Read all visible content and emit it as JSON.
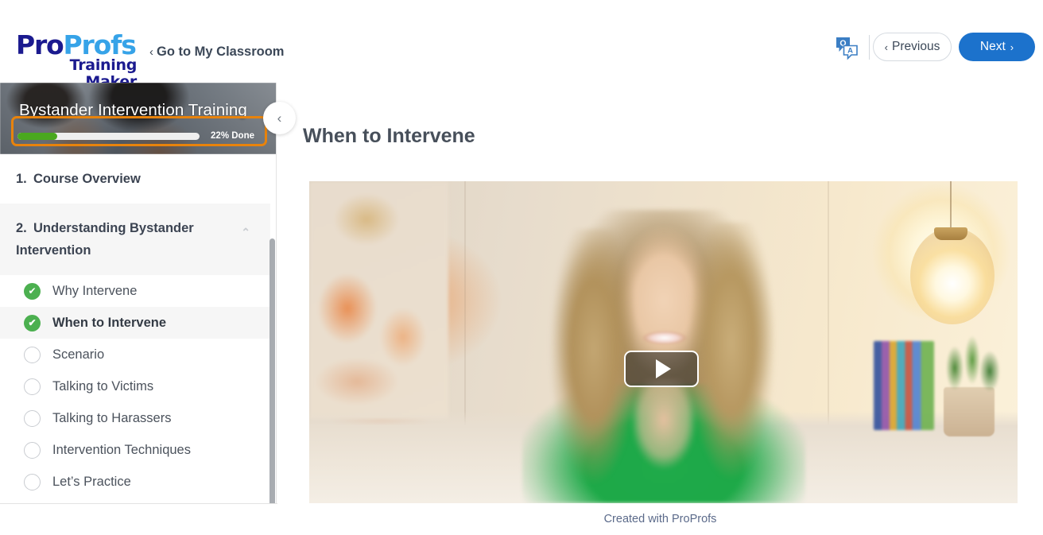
{
  "header": {
    "logo": {
      "part1": "Pro",
      "part2": "Profs",
      "tagline": "Training Maker",
      "color_part1": "#1b1a8f",
      "color_part2": "#36a3e8"
    },
    "classroom_link": "Go to My Classroom",
    "classroom_chevron": "‹",
    "qa_icon_q": "Q",
    "qa_icon_a": "A",
    "previous_label": "Previous",
    "previous_chevron": "‹",
    "next_label": "Next",
    "next_chevron": "›",
    "next_button_color": "#1c72cc"
  },
  "sidebar": {
    "course_title": "Bystander Intervention Training",
    "progress_percent": 22,
    "progress_label": "22% Done",
    "progress_fill_color": "#4aa81f",
    "collapse_chevron": "‹",
    "annotation_color": "#e8830c",
    "sections": [
      {
        "number": "1.",
        "label": "Course Overview",
        "expanded": false,
        "chevron": "",
        "items": []
      },
      {
        "number": "2.",
        "label": "Understanding Bystander Intervention",
        "expanded": true,
        "chevron": "⌃",
        "items": [
          {
            "label": "Why Intervene",
            "status": "done",
            "active": false,
            "check": "✔"
          },
          {
            "label": "When to Intervene",
            "status": "done",
            "active": true,
            "check": "✔"
          },
          {
            "label": "Scenario",
            "status": "todo",
            "active": false,
            "check": ""
          },
          {
            "label": "Talking to Victims",
            "status": "todo",
            "active": false,
            "check": ""
          },
          {
            "label": "Talking to Harassers",
            "status": "todo",
            "active": false,
            "check": ""
          },
          {
            "label": "Intervention Techniques",
            "status": "todo",
            "active": false,
            "check": ""
          },
          {
            "label": "Let’s Practice",
            "status": "todo",
            "active": false,
            "check": ""
          }
        ]
      }
    ]
  },
  "main": {
    "page_title": "When to Intervene",
    "video": {
      "play_label": "Play video"
    }
  },
  "footer": {
    "text": "Created with ProProfs"
  }
}
